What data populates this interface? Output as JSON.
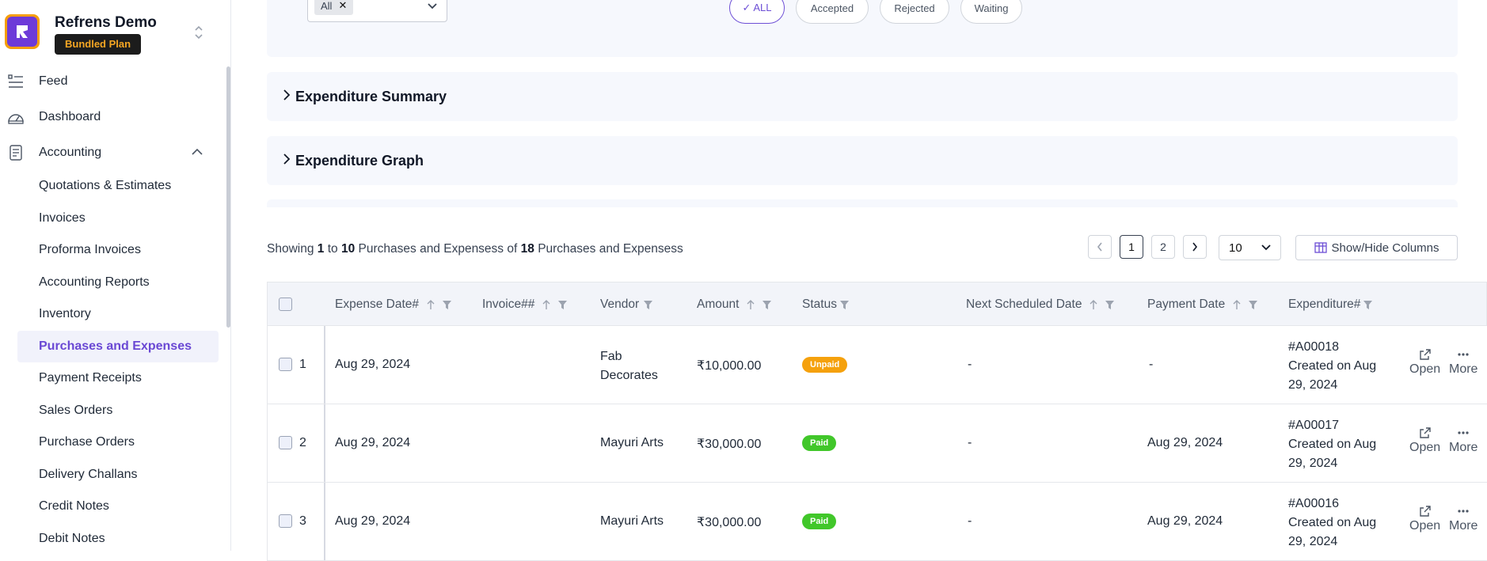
{
  "brand": {
    "name": "Refrens Demo",
    "plan": "Bundled Plan"
  },
  "nav": {
    "feed": "Feed",
    "dashboard": "Dashboard",
    "accounting": "Accounting",
    "sub_items": [
      "Quotations & Estimates",
      "Invoices",
      "Proforma Invoices",
      "Accounting Reports",
      "Inventory",
      "Purchases and Expenses",
      "Payment Receipts",
      "Sales Orders",
      "Purchase Orders",
      "Delivery Challans",
      "Credit Notes",
      "Debit Notes"
    ],
    "active_item": "Purchases and Expenses"
  },
  "filters": {
    "select_chip": "All",
    "pills": [
      "✓ ALL",
      "Accepted",
      "Rejected",
      "Waiting"
    ]
  },
  "sections": {
    "summary": "Expenditure Summary",
    "graph": "Expenditure Graph"
  },
  "pagination": {
    "showing_prefix": "Showing",
    "from": "1",
    "to_word": "to",
    "to": "10",
    "entity": "Purchases and Expensess",
    "of_word": "of",
    "total": "18",
    "pages": [
      "1",
      "2"
    ],
    "current_page": "1",
    "per_page": "10",
    "show_hide_label": "Show/Hide Columns"
  },
  "table": {
    "headers": {
      "expense_date": "Expense Date#",
      "invoice": "Invoice##",
      "vendor": "Vendor",
      "amount": "Amount",
      "status": "Status",
      "next_scheduled": "Next Scheduled Date",
      "payment_date": "Payment Date",
      "expenditure": "Expenditure#"
    },
    "rows": [
      {
        "num": "1",
        "date": "Aug 29, 2024",
        "vendor": "Fab Decorates",
        "amount": "₹10,000.00",
        "status": "Unpaid",
        "next": "-",
        "payment": "-",
        "exp_id": "#A00018",
        "created": "Created on Aug 29, 2024"
      },
      {
        "num": "2",
        "date": "Aug 29, 2024",
        "vendor": "Mayuri Arts",
        "amount": "₹30,000.00",
        "status": "Paid",
        "next": "-",
        "payment": "Aug 29, 2024",
        "exp_id": "#A00017",
        "created": "Created on Aug 29, 2024"
      },
      {
        "num": "3",
        "date": "Aug 29, 2024",
        "vendor": "Mayuri Arts",
        "amount": "₹30,000.00",
        "status": "Paid",
        "next": "-",
        "payment": "Aug 29, 2024",
        "exp_id": "#A00016",
        "created": "Created on Aug 29, 2024"
      }
    ],
    "actions": {
      "open": "Open",
      "more": "More"
    }
  },
  "colors": {
    "accent": "#6d4fd6",
    "unpaid": "#f5a10d",
    "paid": "#41c72a",
    "brand_bg": "#6d3ad8",
    "plan_text": "#f5a623"
  }
}
